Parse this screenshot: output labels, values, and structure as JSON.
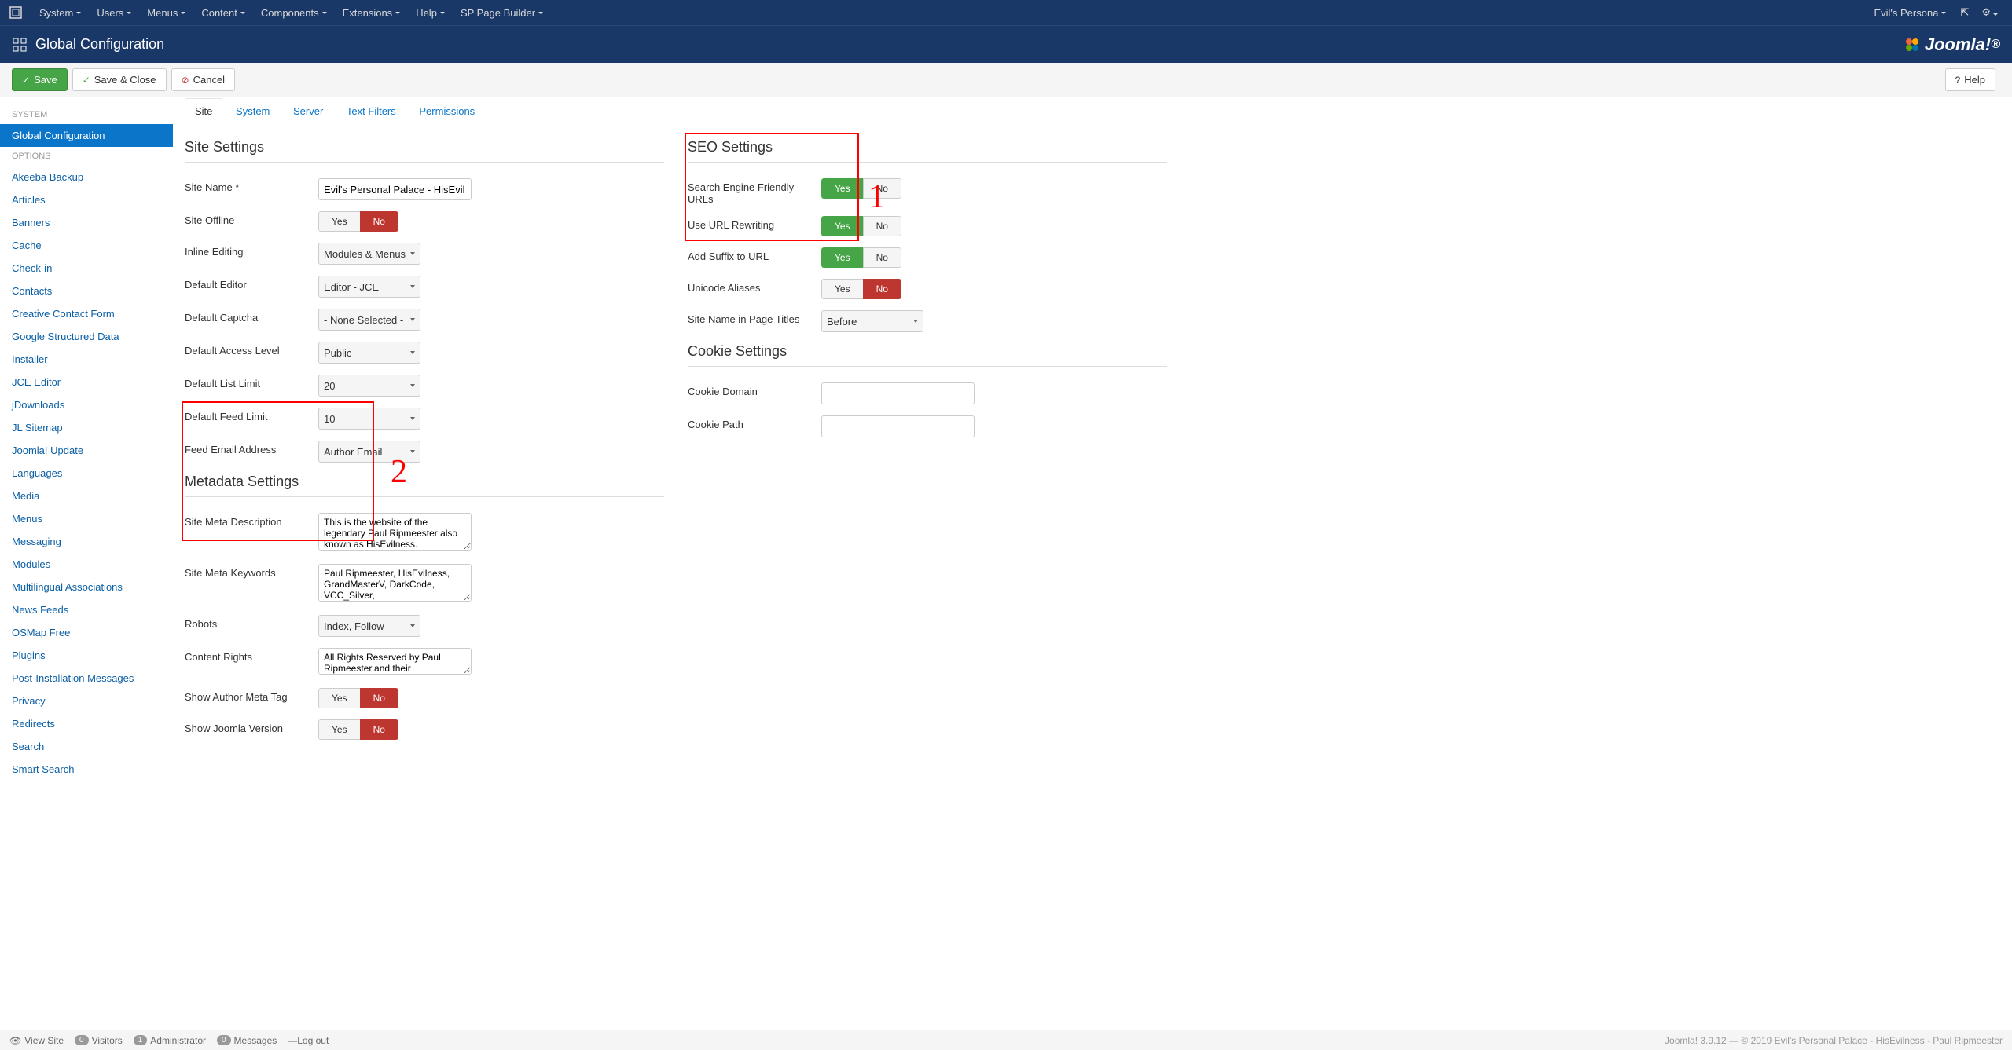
{
  "topbar": {
    "menus": [
      "System",
      "Users",
      "Menus",
      "Content",
      "Components",
      "Extensions",
      "Help",
      "SP Page Builder"
    ],
    "user_label": "Evil's Persona"
  },
  "titlebar": {
    "title": "Global Configuration",
    "brand": "Joomla!"
  },
  "toolbar": {
    "save": "Save",
    "save_close": "Save & Close",
    "cancel": "Cancel",
    "help": "Help"
  },
  "sidebar": {
    "header_system": "SYSTEM",
    "global_config": "Global Configuration",
    "header_options": "OPTIONS",
    "items": [
      "Akeeba Backup",
      "Articles",
      "Banners",
      "Cache",
      "Check-in",
      "Contacts",
      "Creative Contact Form",
      "Google Structured Data",
      "Installer",
      "JCE Editor",
      "jDownloads",
      "JL Sitemap",
      "Joomla! Update",
      "Languages",
      "Media",
      "Menus",
      "Messaging",
      "Modules",
      "Multilingual Associations",
      "News Feeds",
      "OSMap Free",
      "Plugins",
      "Post-Installation Messages",
      "Privacy",
      "Redirects",
      "Search",
      "Smart Search"
    ]
  },
  "tabs": [
    "Site",
    "System",
    "Server",
    "Text Filters",
    "Permissions"
  ],
  "site_settings": {
    "heading": "Site Settings",
    "site_name_label": "Site Name *",
    "site_name_value": "Evil's Personal Palace - HisEvil",
    "site_offline_label": "Site Offline",
    "inline_editing_label": "Inline Editing",
    "inline_editing_value": "Modules & Menus",
    "default_editor_label": "Default Editor",
    "default_editor_value": "Editor - JCE",
    "default_captcha_label": "Default Captcha",
    "default_captcha_value": "- None Selected -",
    "default_access_label": "Default Access Level",
    "default_access_value": "Public",
    "default_list_limit_label": "Default List Limit",
    "default_list_limit_value": "20",
    "default_feed_limit_label": "Default Feed Limit",
    "default_feed_limit_value": "10",
    "feed_email_label": "Feed Email Address",
    "feed_email_value": "Author Email"
  },
  "metadata_settings": {
    "heading": "Metadata Settings",
    "meta_desc_label": "Site Meta Description",
    "meta_desc_value": "This is the website of the legendary Paul Ripmeester also known as HisEvilness.",
    "meta_keywords_label": "Site Meta Keywords",
    "meta_keywords_value": "Paul Ripmeester, HisEvilness, GrandMasterV, DarkCode, VCC_Silver,",
    "robots_label": "Robots",
    "robots_value": "Index, Follow",
    "content_rights_label": "Content Rights",
    "content_rights_value": "All Rights Reserved by Paul Ripmeester.and their",
    "show_author_label": "Show Author Meta Tag",
    "show_joomla_label": "Show Joomla Version"
  },
  "seo_settings": {
    "heading": "SEO Settings",
    "sef_label": "Search Engine Friendly URLs",
    "rewrite_label": "Use URL Rewriting",
    "suffix_label": "Add Suffix to URL",
    "unicode_label": "Unicode Aliases",
    "sitename_pagetitles_label": "Site Name in Page Titles",
    "sitename_pagetitles_value": "Before"
  },
  "cookie_settings": {
    "heading": "Cookie Settings",
    "domain_label": "Cookie Domain",
    "path_label": "Cookie Path"
  },
  "yesno": {
    "yes": "Yes",
    "no": "No"
  },
  "statusbar": {
    "view_site": "View Site",
    "visitors": "Visitors",
    "visitors_count": "0",
    "administrator": "Administrator",
    "administrator_count": "1",
    "messages": "Messages",
    "messages_count": "0",
    "logout": "Log out",
    "footer_right": "Joomla! 3.9.12 — © 2019 Evil's Personal Palace - HisEvilness - Paul Ripmeester"
  },
  "annotations": {
    "one": "1",
    "two": "2"
  }
}
